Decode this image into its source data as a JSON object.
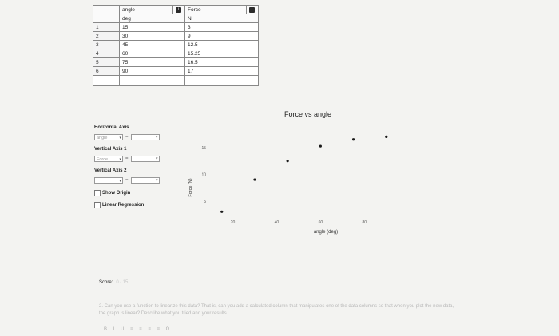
{
  "table": {
    "columns": [
      {
        "name": "angle",
        "unit": "deg",
        "button": "i"
      },
      {
        "name": "Force",
        "unit": "N",
        "button": "i"
      }
    ],
    "rows": [
      {
        "n": "1",
        "angle": "15",
        "force": "3"
      },
      {
        "n": "2",
        "angle": "30",
        "force": "9"
      },
      {
        "n": "3",
        "angle": "45",
        "force": "12.5"
      },
      {
        "n": "4",
        "angle": "60",
        "force": "15.25"
      },
      {
        "n": "5",
        "angle": "75",
        "force": "16.5"
      },
      {
        "n": "6",
        "angle": "90",
        "force": "17"
      }
    ]
  },
  "controls": {
    "horizontal_label": "Horizontal Axis",
    "horizontal_value": "angle",
    "vertical1_label": "Vertical Axis 1",
    "vertical1_value": "Force",
    "vertical2_label": "Vertical Axis 2",
    "vertical2_value": "",
    "equals": "=",
    "show_origin": "Show Origin",
    "linear_regression": "Linear Regression"
  },
  "chart_data": {
    "type": "scatter",
    "title": "Force vs angle",
    "xlabel": "angle (deg)",
    "ylabel": "Force (N)",
    "x_ticks": [
      20,
      40,
      60,
      80
    ],
    "y_ticks": [
      5,
      10,
      15
    ],
    "xlim": [
      10,
      93
    ],
    "ylim": [
      2,
      19
    ],
    "grid": false,
    "legend": "none",
    "point_color": "#1a1a1a",
    "series": [
      {
        "x": [
          15,
          30,
          45,
          60,
          75,
          90
        ],
        "y": [
          3,
          9,
          12.5,
          15.25,
          16.5,
          17
        ]
      }
    ]
  },
  "footer": {
    "score_label": "Score:",
    "score_value": "0 / 15",
    "question": "2. Can you use a function to linearize this data? That is, can you add a calculated column that manipulates one of the data columns so that when you plot the new data, the graph is linear? Describe what you tried and your results.",
    "toolbar": "B I U ≡ ≡ ≡ ≡ Ω"
  }
}
